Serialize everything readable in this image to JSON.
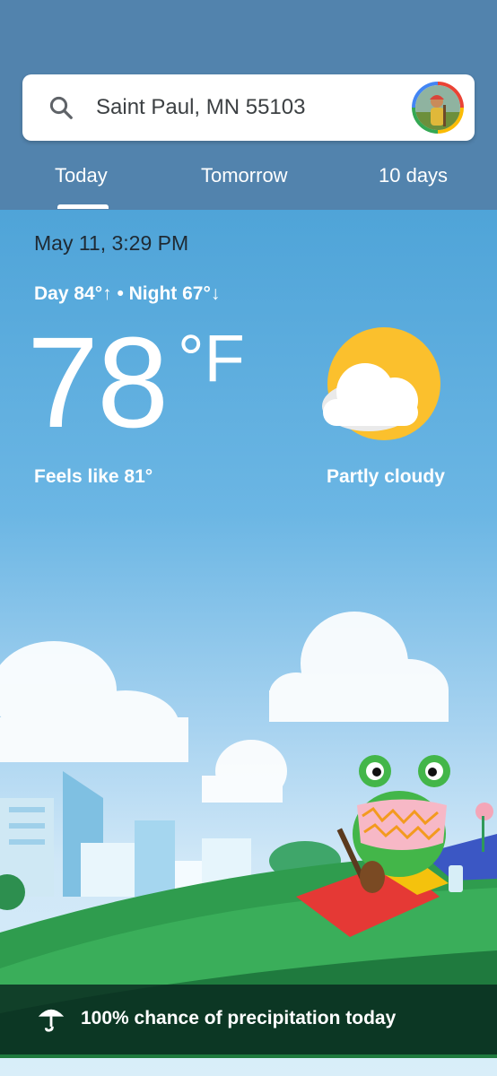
{
  "search": {
    "location": "Saint Paul, MN 55103",
    "icon": "search-icon"
  },
  "avatar": {
    "icon": "avatar"
  },
  "tabs": [
    {
      "label": "Today",
      "selected": true
    },
    {
      "label": "Tomorrow",
      "selected": false
    },
    {
      "label": "10 days",
      "selected": false
    }
  ],
  "weather": {
    "datetime": "May 11, 3:29 PM",
    "day_night": "Day 84°↑ • Night 67°↓",
    "temperature": "78",
    "unit": "°F",
    "feels_like": "Feels like 81°",
    "condition": "Partly cloudy",
    "condition_icon": "partly-cloudy-icon"
  },
  "precipitation": {
    "text": "100% chance of precipitation today",
    "icon": "umbrella-icon"
  },
  "colors": {
    "header": "#5283ad",
    "sky_top": "#4fa4d8",
    "sun": "#fbc02d",
    "cloud": "#ffffff"
  }
}
